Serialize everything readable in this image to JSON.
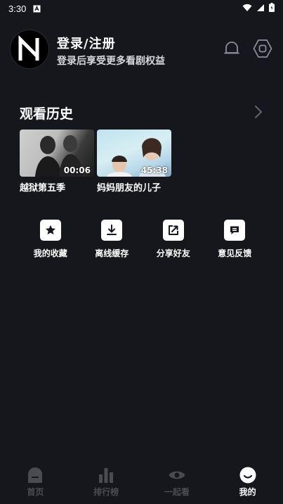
{
  "status_bar": {
    "time": "3:30"
  },
  "profile": {
    "title": "登录/注册",
    "subtitle": "登录后享受更多看剧权益"
  },
  "history": {
    "title": "观看历史",
    "items": [
      {
        "title": "越狱第五季",
        "duration": "00:06"
      },
      {
        "title": "妈妈朋友的儿子",
        "duration": "45:38"
      }
    ]
  },
  "actions": [
    {
      "label": "我的收藏",
      "icon": "star-icon"
    },
    {
      "label": "离线缓存",
      "icon": "download-icon"
    },
    {
      "label": "分享好友",
      "icon": "share-icon"
    },
    {
      "label": "意见反馈",
      "icon": "feedback-icon"
    }
  ],
  "tabbar": [
    {
      "label": "首页",
      "icon": "home-icon",
      "active": false
    },
    {
      "label": "排行榜",
      "icon": "ranking-icon",
      "active": false
    },
    {
      "label": "一起看",
      "icon": "eye-icon",
      "active": false
    },
    {
      "label": "我的",
      "icon": "profile-face-icon",
      "active": true
    }
  ],
  "colors": {
    "background": "#16171c",
    "text": "#ffffff",
    "inactive_tab": "#4b4c52"
  }
}
